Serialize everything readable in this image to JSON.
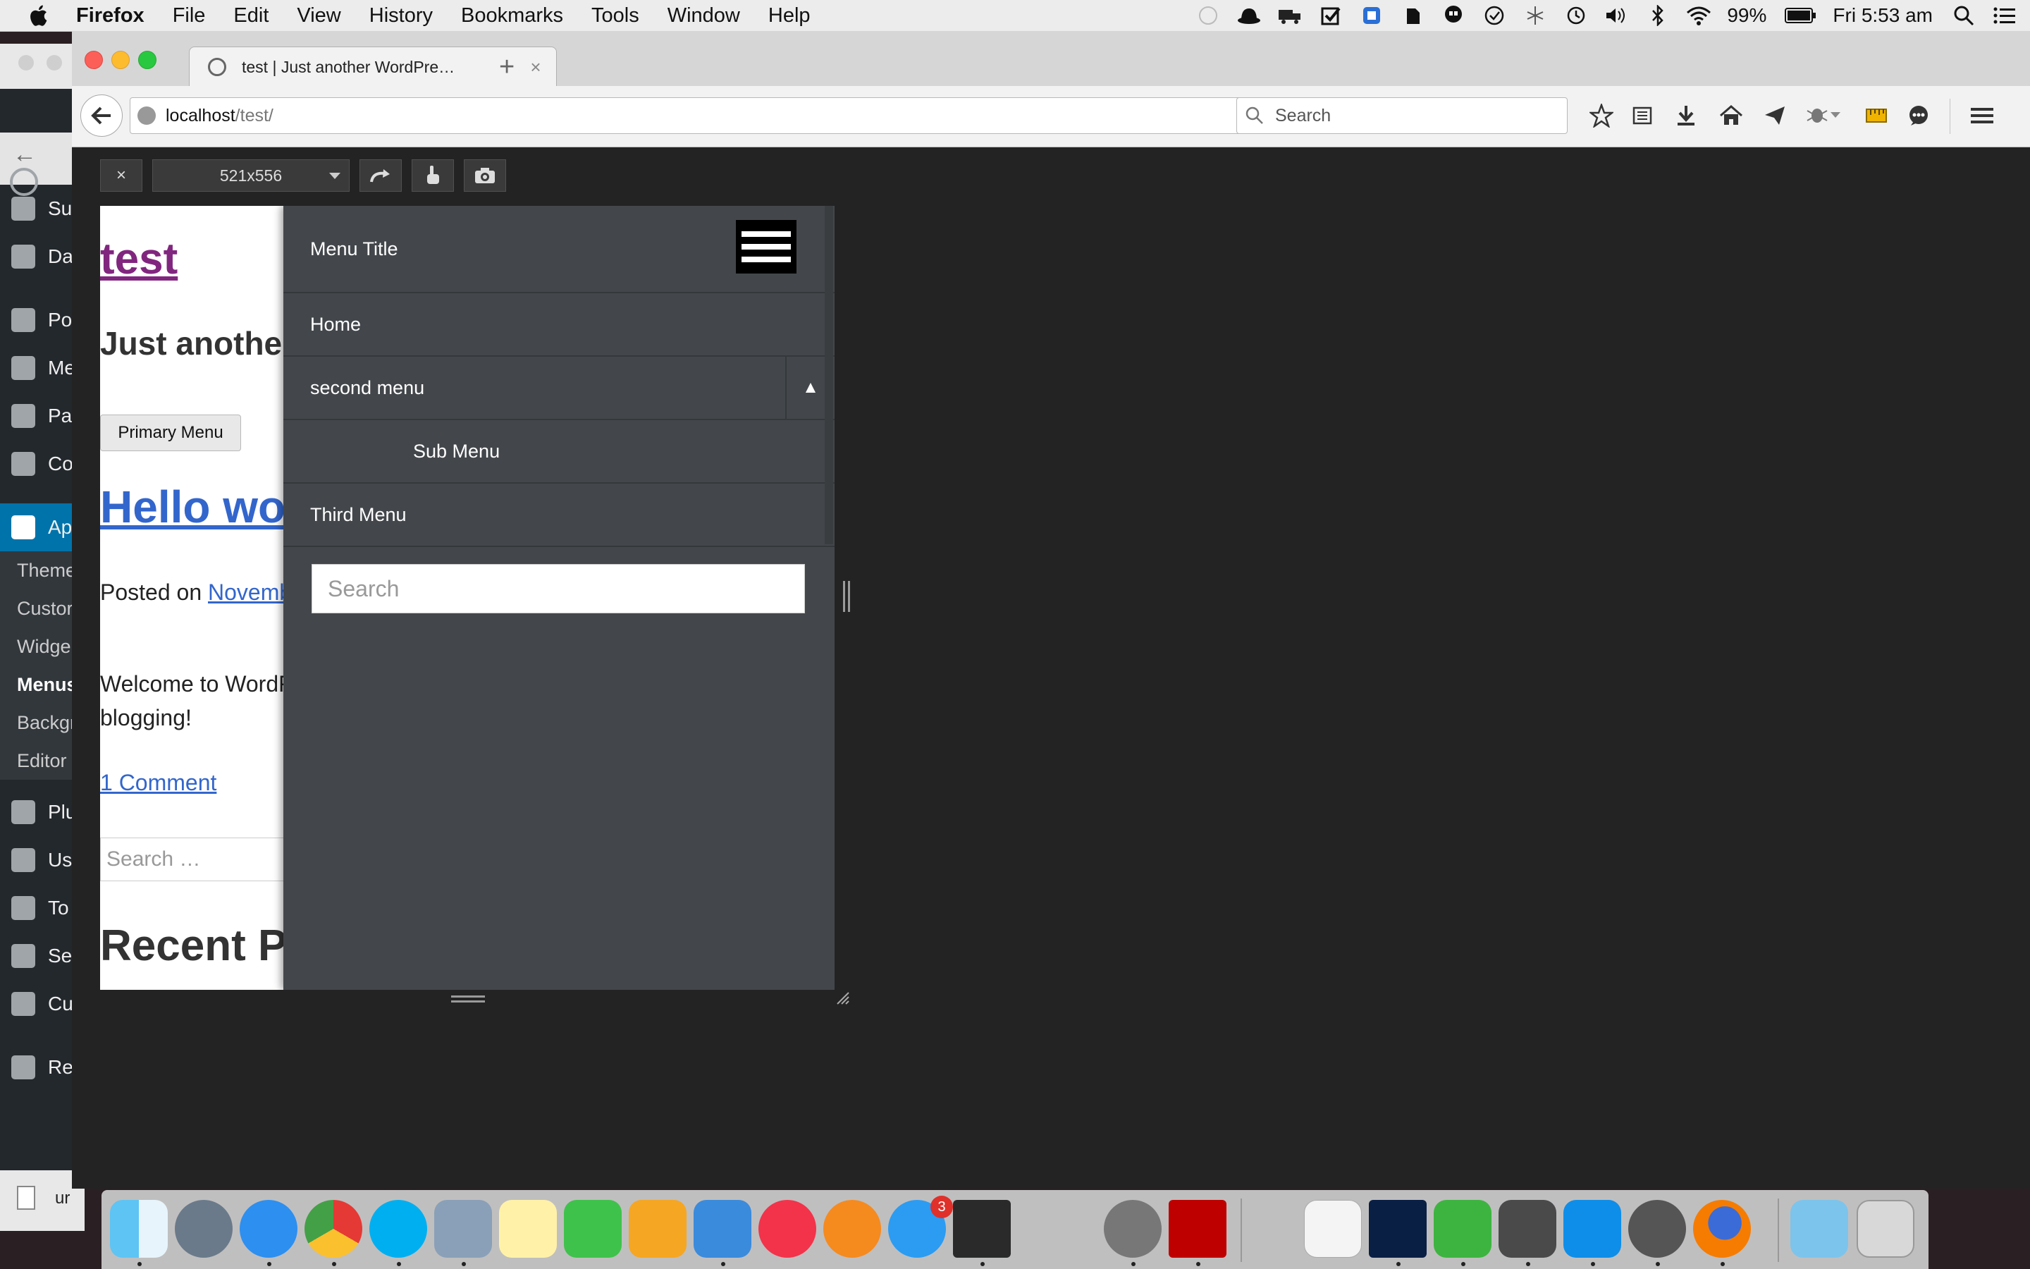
{
  "menubar": {
    "app_name": "Firefox",
    "items": [
      "File",
      "Edit",
      "View",
      "History",
      "Bookmarks",
      "Tools",
      "Window",
      "Help"
    ],
    "battery": "99%",
    "clock": "Fri 5:53 am"
  },
  "wp_admin": {
    "sidebar_items": [
      "Su",
      "Da",
      "Po",
      "Me",
      "Pa",
      "Co",
      "Ap"
    ],
    "submenu": [
      "Theme",
      "Custor",
      "Widge",
      "Menus",
      "Backgr",
      "Editor"
    ],
    "sidebar_items_after": [
      "Plu",
      "Us",
      "To",
      "Se",
      "Cu",
      "Re"
    ],
    "bottom_tab": "ur"
  },
  "browser": {
    "tab_title": "test | Just another WordPre…",
    "url_host": "localhost",
    "url_path": "/test/",
    "search_placeholder": "Search"
  },
  "responsive_toolbar": {
    "close_label": "×",
    "size_label": "521x556"
  },
  "site": {
    "title": "test",
    "description": "Just another",
    "primary_menu_button": "Primary Menu",
    "post_title": "Hello wo",
    "posted_prefix": "Posted on ",
    "posted_link": "Novemb",
    "welcome_line1": "Welcome to WordF",
    "welcome_line2": "blogging!",
    "comments_link": "1 Comment",
    "search_placeholder": "Search …",
    "recent_heading": "Recent P"
  },
  "slide_menu": {
    "title": "Menu Title",
    "items": [
      "Home",
      "second menu",
      "Sub Menu",
      "Third Menu"
    ],
    "toggle_symbol": "▲",
    "search_placeholder": "Search"
  },
  "dock": {
    "app_store_badge": "3"
  },
  "colors": {
    "panel_bg": "#43474b",
    "wp_admin_active": "#0073aa",
    "site_title": "#81267f",
    "link": "#3366cc"
  }
}
